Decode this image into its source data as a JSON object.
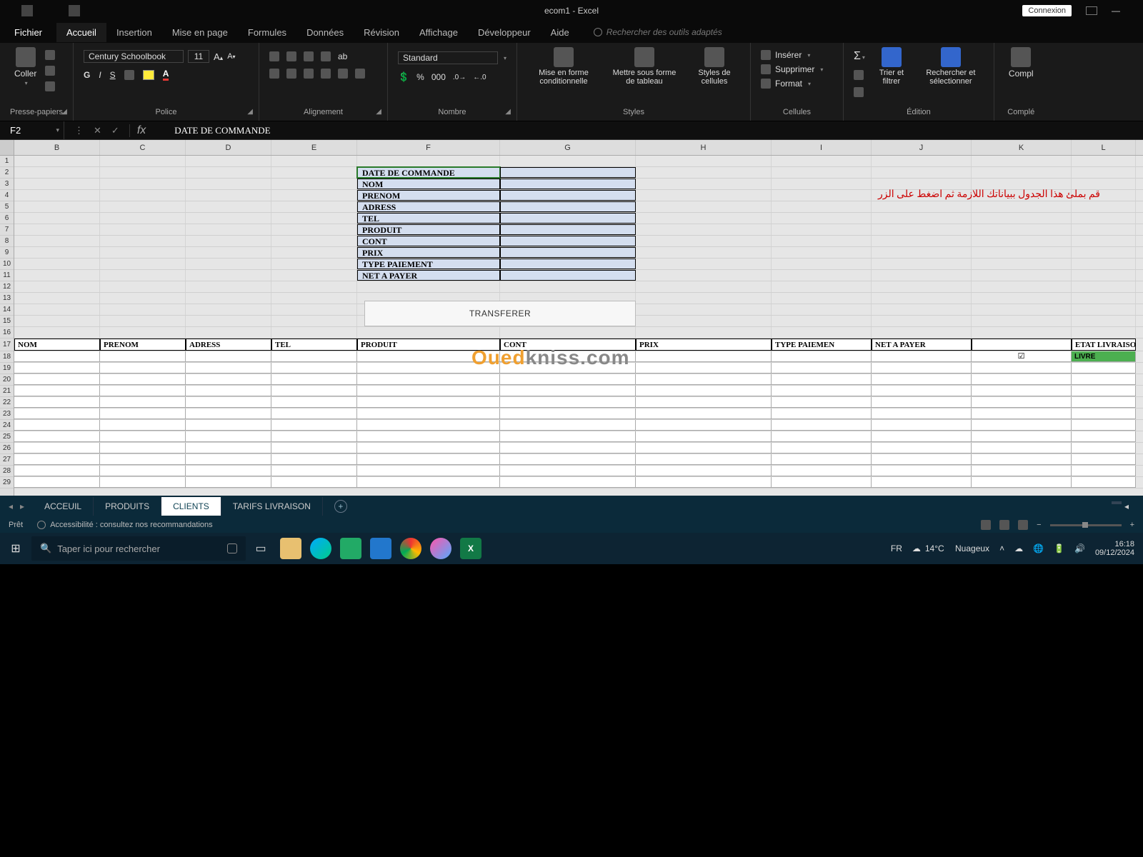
{
  "titlebar": {
    "filename": "ecom1 - Excel",
    "connexion": "Connexion"
  },
  "tabs": {
    "file": "Fichier",
    "home": "Accueil",
    "insert": "Insertion",
    "layout": "Mise en page",
    "formulas": "Formules",
    "data": "Données",
    "review": "Révision",
    "view": "Affichage",
    "dev": "Développeur",
    "help": "Aide",
    "search": "Rechercher des outils adaptés"
  },
  "ribbon": {
    "clipboard": {
      "label": "Presse-papiers",
      "paste": "Coller"
    },
    "font": {
      "label": "Police",
      "name": "Century Schoolbook",
      "size": "11",
      "b": "G",
      "i": "I",
      "u": "S"
    },
    "align": {
      "label": "Alignement"
    },
    "number": {
      "label": "Nombre",
      "std": "Standard"
    },
    "styles": {
      "label": "Styles",
      "cond": "Mise en forme conditionnelle",
      "table": "Mettre sous forme de tableau",
      "cell": "Styles de cellules"
    },
    "cells": {
      "label": "Cellules",
      "insert": "Insérer",
      "delete": "Supprimer",
      "format": "Format"
    },
    "edit": {
      "label": "Édition",
      "sort": "Trier et filtrer",
      "find": "Rechercher et sélectionner"
    },
    "compl": {
      "top": "Compl",
      "bottom": "Complé"
    }
  },
  "namebox": "F2",
  "formula": "DATE DE COMMANDE",
  "cols": [
    "B",
    "C",
    "D",
    "E",
    "F",
    "G",
    "H",
    "I",
    "J",
    "K",
    "L"
  ],
  "rows": [
    "1",
    "2",
    "3",
    "4",
    "5",
    "6",
    "7",
    "8",
    "9",
    "10",
    "11",
    "12",
    "13",
    "14",
    "15",
    "16",
    "17",
    "18",
    "19",
    "20",
    "21",
    "22",
    "23",
    "24",
    "25",
    "26",
    "27",
    "28",
    "29"
  ],
  "form": [
    "DATE DE COMMANDE",
    "NOM",
    "PRENOM",
    "ADRESS",
    "TEL",
    "PRODUIT",
    "CONT",
    "PRIX",
    "TYPE PAIEMENT",
    "NET A PAYER"
  ],
  "arabic": "قم بملئ هذا الجدول ببياناتك اللازمة ثم اضغط على الزر",
  "transfer": "TRANSFERER",
  "dataheaders": [
    "NOM",
    "PRENOM",
    "ADRESS",
    "TEL",
    "PRODUIT",
    "CONT",
    "PRIX",
    "TYPE PAIEMEN",
    "NET A PAYER",
    "",
    "ETAT LIVRAISON"
  ],
  "livre": "LIVRE",
  "sheets": {
    "acceuil": "ACCEUIL",
    "produits": "PRODUITS",
    "clients": "CLIENTS",
    "tarifs": "TARIFS LIVRAISON"
  },
  "status": {
    "ready": "Prêt",
    "access": "Accessibilité : consultez nos recommandations"
  },
  "taskbar": {
    "search": "Taper ici pour rechercher",
    "lang": "FR",
    "temp": "14°C",
    "weather": "Nuageux",
    "time": "16:18",
    "date": "09/12/2024"
  },
  "watermark": {
    "a": "Oued",
    "b": "kniss",
    "c": ".com"
  }
}
